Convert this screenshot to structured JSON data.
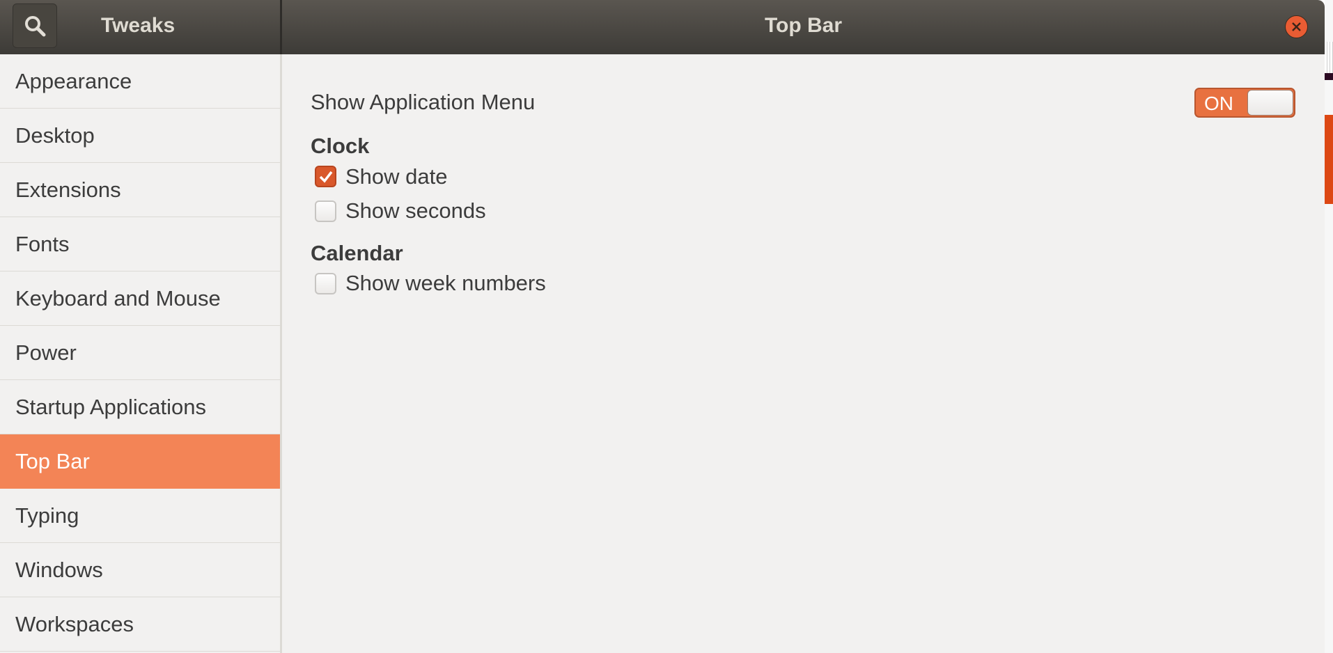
{
  "app": {
    "title": "Tweaks",
    "search_icon": "search-icon"
  },
  "header": {
    "title": "Top Bar",
    "close_icon": "close-icon"
  },
  "sidebar": {
    "items": [
      {
        "label": "Appearance"
      },
      {
        "label": "Desktop"
      },
      {
        "label": "Extensions"
      },
      {
        "label": "Fonts"
      },
      {
        "label": "Keyboard and Mouse"
      },
      {
        "label": "Power"
      },
      {
        "label": "Startup Applications"
      },
      {
        "label": "Top Bar",
        "selected": true
      },
      {
        "label": "Typing"
      },
      {
        "label": "Windows"
      },
      {
        "label": "Workspaces"
      }
    ]
  },
  "main": {
    "app_menu": {
      "label": "Show Application Menu",
      "toggle_label": "ON",
      "on": true
    },
    "clock": {
      "heading": "Clock",
      "show_date": {
        "label": "Show date",
        "checked": true
      },
      "show_seconds": {
        "label": "Show seconds",
        "checked": false
      }
    },
    "calendar": {
      "heading": "Calendar",
      "show_week_numbers": {
        "label": "Show week numbers",
        "checked": false
      }
    }
  },
  "colors": {
    "accent": "#f38456",
    "toggle": "#e87140",
    "checkbox": "#d9582b",
    "header": "#4a4742",
    "close": "#e95c33"
  }
}
